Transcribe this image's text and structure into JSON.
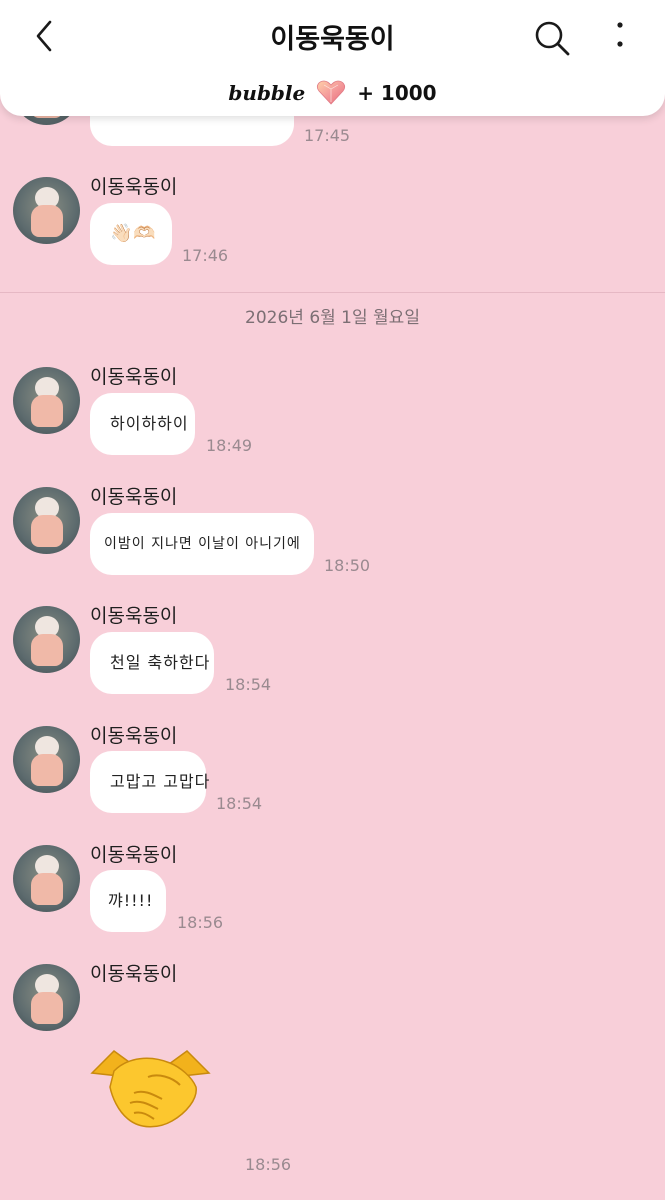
{
  "header": {
    "title": "이동욱동이",
    "bubble_word": "bubble",
    "bubble_count": "+ 1000"
  },
  "date_divider": "2026년 6월 1일 월요일",
  "messages": [
    {
      "sender": "",
      "text": "",
      "time": "17:45"
    },
    {
      "sender": "이동욱동이",
      "text": "👋🏻🫶🏻",
      "time": "17:46"
    },
    {
      "sender": "이동욱동이",
      "text": "하이하하이",
      "time": "18:49"
    },
    {
      "sender": "이동욱동이",
      "text": "이밤이 지나면 이날이 아니기에",
      "time": "18:50"
    },
    {
      "sender": "이동욱동이",
      "text": "천일 축하한다",
      "time": "18:54"
    },
    {
      "sender": "이동욱동이",
      "text": "고맙고 고맙다",
      "time": "18:54"
    },
    {
      "sender": "이동욱동이",
      "text": "꺄!!!!",
      "time": "18:56"
    },
    {
      "sender": "이동욱동이",
      "text": "",
      "emoji": "handshake",
      "time": "18:56"
    }
  ],
  "colors": {
    "background": "#f8cfd9",
    "bubble": "#ffffff",
    "header": "#ffffff"
  },
  "icons": [
    "back-arrow-icon",
    "search-icon",
    "more-vertical-icon",
    "heart-gem-icon",
    "handshake-emoji"
  ]
}
